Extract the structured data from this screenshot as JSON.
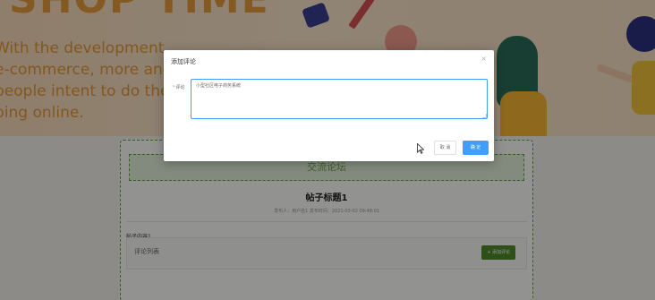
{
  "banner": {
    "big_title": "SHOP TIME",
    "lines": [
      "With the development of the",
      "e-commerce, more and more",
      "people intent to do the s",
      "ping online."
    ]
  },
  "forum": {
    "header": "交流论坛",
    "post_title": "帖子标题1",
    "post_meta": "发布人：用户名1  发布时间：2021-03-02 09:48:01",
    "post_content": "帖子内容1",
    "comments_label": "评论列表",
    "add_comment_label": "+ 添加评论"
  },
  "dialog": {
    "title": "添加评论",
    "close_icon": "×",
    "comment_label": "评论",
    "required_mark": "*",
    "comment_value": "小型社区电子商务系统",
    "cancel_label": "取 消",
    "ok_label": "确 定"
  },
  "colors": {
    "accent": "#409eff",
    "forum_green": "#5aa63b",
    "banner_orange": "#e59a3c"
  }
}
